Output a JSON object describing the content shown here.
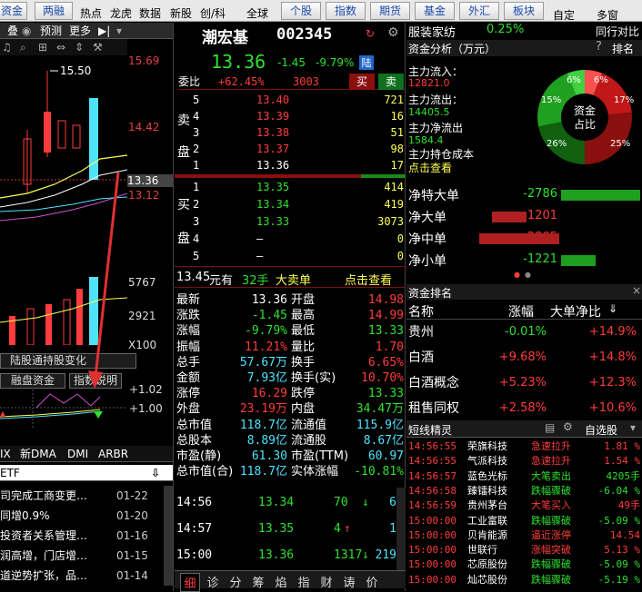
{
  "top_tabs": {
    "left_tab1": "资金",
    "left_tab2": "两融",
    "plain": [
      "热点",
      "龙虎",
      "数据",
      "新股",
      "创/科",
      "全球"
    ],
    "tabs": [
      "个股",
      "指数",
      "期货",
      "基金",
      "外汇",
      "板块"
    ],
    "right_plain": [
      "自定",
      "多窗"
    ]
  },
  "left_chart": {
    "toolbar": [
      "叠",
      "预测",
      "更多"
    ],
    "price_high_label": "15.50",
    "y_labels": [
      "15.69",
      "14.42",
      "13.36",
      "13.12"
    ],
    "volume_labels": [
      "5767",
      "2921",
      "X100"
    ],
    "tabs_row1": [
      "陆股通持股变化"
    ],
    "tabs_row2": [
      "融盘资金",
      "指数说明"
    ],
    "ind_labels": [
      "+1.02",
      "+1.00"
    ],
    "indicator_tabs": [
      "IX",
      "新DMA",
      "DMI",
      "ARBR"
    ],
    "etf_label": "ETF",
    "news": [
      {
        "text": "司完成工商变更…",
        "date": "01-22"
      },
      {
        "text": "同增0.9%",
        "date": "01-20"
      },
      {
        "text": "投资者关系管理…",
        "date": "01-16"
      },
      {
        "text": "润高增，门店增…",
        "date": "01-15"
      },
      {
        "text": "道逆势扩张，品…",
        "date": "01-14"
      }
    ]
  },
  "quote": {
    "name": "潮宏基",
    "code": "002345",
    "price": "13.36",
    "change": "-1.45",
    "change_pct": "-9.79%",
    "badge": "陆",
    "weibi_label": "委比",
    "weibi": "+62.45%",
    "weicha": "3003",
    "buy_btn": "买",
    "sell_btn": "卖",
    "sell_side_label": [
      "卖",
      "盘"
    ],
    "buy_side_label": [
      "买",
      "盘"
    ],
    "asks": [
      {
        "lvl": "5",
        "price": "13.40",
        "vol": "721"
      },
      {
        "lvl": "4",
        "price": "13.39",
        "vol": "16"
      },
      {
        "lvl": "3",
        "price": "13.38",
        "vol": "51"
      },
      {
        "lvl": "2",
        "price": "13.37",
        "vol": "98"
      },
      {
        "lvl": "1",
        "price": "13.36",
        "vol": "17"
      }
    ],
    "bids": [
      {
        "lvl": "1",
        "price": "13.35",
        "vol": "414"
      },
      {
        "lvl": "2",
        "price": "13.34",
        "vol": "419"
      },
      {
        "lvl": "3",
        "price": "13.33",
        "vol": "3073"
      },
      {
        "lvl": "4",
        "price": "—",
        "vol": "0"
      },
      {
        "lvl": "5",
        "price": "—",
        "vol": "0"
      }
    ],
    "bigorder": {
      "amount": "13.45",
      "unit": "元有",
      "hands": "32手",
      "label": "大卖单",
      "link": "点击查看"
    },
    "stats": [
      {
        "k1": "最新",
        "v1": "13.36",
        "k2": "开盘",
        "v2": "14.98"
      },
      {
        "k1": "涨跌",
        "v1": "-1.45",
        "k2": "最高",
        "v2": "14.99"
      },
      {
        "k1": "涨幅",
        "v1": "-9.79%",
        "k2": "最低",
        "v2": "13.33"
      },
      {
        "k1": "振幅",
        "v1": "11.21%",
        "k2": "量比",
        "v2": "1.70"
      },
      {
        "k1": "总手",
        "v1": "57.67万",
        "k2": "换手",
        "v2": "6.65%"
      },
      {
        "k1": "金额",
        "v1": "7.93亿",
        "k2": "换手(实)",
        "v2": "10.70%"
      },
      {
        "k1": "涨停",
        "v1": "16.29",
        "k2": "跌停",
        "v2": "13.33"
      },
      {
        "k1": "外盘",
        "v1": "23.19万",
        "k2": "内盘",
        "v2": "34.47万"
      },
      {
        "k1": "总市值",
        "v1": "118.7亿",
        "k2": "流通值",
        "v2": "115.9亿"
      },
      {
        "k1": "总股本",
        "v1": "8.89亿",
        "k2": "流通股",
        "v2": "8.67亿"
      },
      {
        "k1": "市盈(静)",
        "v1": "61.30",
        "k2": "市盈(TTM)",
        "v2": "60.97"
      },
      {
        "k1": "总市值(合)",
        "v1": "118.7亿",
        "k2": "实体涨幅",
        "v2": "-10.81%"
      }
    ],
    "ticks": [
      {
        "time": "14:56",
        "price": "13.34",
        "vol": "70",
        "dir": "down",
        "num": "6"
      },
      {
        "time": "14:57",
        "price": "13.35",
        "vol": "4",
        "dir": "up",
        "num": "1"
      },
      {
        "time": "15:00",
        "price": "13.36",
        "vol": "1317",
        "dir": "down",
        "num": "219"
      }
    ],
    "bottom_tabs": [
      "细",
      "诊",
      "分",
      "筹",
      "焰",
      "指",
      "财",
      "诪",
      "价"
    ]
  },
  "right": {
    "sector": "服装家纺",
    "sector_pct": "0.25%",
    "compare": "同行对比",
    "analysis_title": "资金分析（万元）",
    "rank_btn": "排名",
    "inflow_label": "主力流入：",
    "inflow": "12821.0",
    "outflow_label": "主力流出：",
    "outflow": "14405.5",
    "net_label": "主力净流出",
    "net": "1584.4",
    "cost_label": "主力持仓成本",
    "cost_link": "点击查看",
    "pie_center": [
      "资金",
      "占比"
    ],
    "pie_labels": [
      "6%",
      "6%",
      "17%",
      "15%",
      "26%",
      "25%"
    ],
    "flows": [
      {
        "name": "净特大单",
        "value": "-2786"
      },
      {
        "name": "净大单",
        "value": "1201"
      },
      {
        "name": "净中单",
        "value": "2805"
      },
      {
        "name": "净小单",
        "value": "-1221"
      }
    ],
    "rank_title": "资金排名",
    "rank_headers": [
      "名称",
      "涨幅",
      "大单净比"
    ],
    "ranks": [
      {
        "name": "贵州",
        "pct": "-0.01%",
        "net": "+14.9%"
      },
      {
        "name": "白酒",
        "pct": "+9.68%",
        "net": "+14.8%"
      },
      {
        "name": "白酒概念",
        "pct": "+5.23%",
        "net": "+12.3%"
      },
      {
        "name": "租售同权",
        "pct": "+2.58%",
        "net": "+10.6%"
      }
    ],
    "jx_title": "短线精灵",
    "jx_filter": "自选股",
    "jingling": [
      {
        "time": "14:56:55",
        "name": "荣旗科技",
        "event": "急速拉升",
        "val": "1.81 %",
        "color": "red"
      },
      {
        "time": "14:56:55",
        "name": "气派科技",
        "event": "急速拉升",
        "val": "1.54 %",
        "color": "red"
      },
      {
        "time": "14:56:57",
        "name": "蓝色光标",
        "event": "大笔卖出",
        "val": "4205手",
        "color": "green"
      },
      {
        "time": "14:56:58",
        "name": "臻镭科技",
        "event": "跌幅骤破",
        "val": "-6.04 %",
        "color": "green"
      },
      {
        "time": "14:56:59",
        "name": "贵州茅台",
        "event": "大笔买入",
        "val": "49手",
        "color": "red"
      },
      {
        "time": "15:00:00",
        "name": "工业富联",
        "event": "跌幅骤破",
        "val": "-5.09 %",
        "color": "green"
      },
      {
        "time": "15:00:00",
        "name": "贝肯能源",
        "event": "逼近涨停",
        "val": "14.54",
        "color": "red"
      },
      {
        "time": "15:00:00",
        "name": "世联行",
        "event": "涨幅突破",
        "val": "5.13 %",
        "color": "red"
      },
      {
        "time": "15:00:00",
        "name": "芯原股份",
        "event": "跌幅骤破",
        "val": "-5.09 %",
        "color": "green"
      },
      {
        "time": "15:00:00",
        "name": "灿芯股份",
        "event": "跌幅骤破",
        "val": "-5.19 %",
        "color": "green"
      }
    ]
  }
}
